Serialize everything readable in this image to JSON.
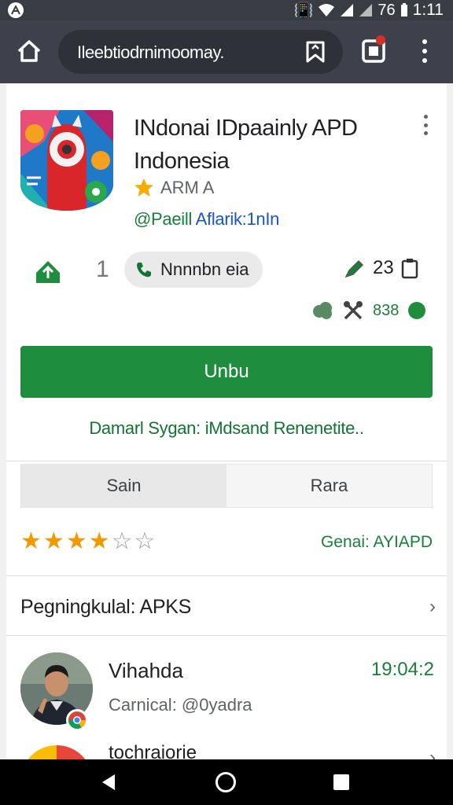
{
  "status_bar": {
    "battery": "76",
    "time": "1:11"
  },
  "toolbar": {
    "url": "Ileebtiodrnimoomay."
  },
  "app": {
    "title_line1": "INdonai IDpaainly APD",
    "title_line2": "Indonesia",
    "rating_label": "ARM A",
    "dev_prefix": "@Paeill",
    "dev_link": "Aflarik:1nIn"
  },
  "stats": {
    "count": "1",
    "call_label": "Nnnnbn eia",
    "right_value": "23",
    "icon_value": "838"
  },
  "install_label": "Unbu",
  "promo_text": "Damarl Sygan: iMdsand Renenetite..",
  "segments": {
    "left": "Sain",
    "right": "Rara"
  },
  "rating": {
    "stars": 4,
    "max": 6,
    "genre": "Genai: AYIAPD"
  },
  "section": {
    "title": "Pegningkulal: APKS"
  },
  "review": {
    "name": "Vihahda",
    "date": "19:04:2",
    "subtitle": "Carnical: @0yadra"
  },
  "next_item": {
    "title": "tochraiorie"
  },
  "colors": {
    "accent_green": "#1e8e3e",
    "toolbar": "#3e414b",
    "link_blue": "#1a56c4"
  }
}
